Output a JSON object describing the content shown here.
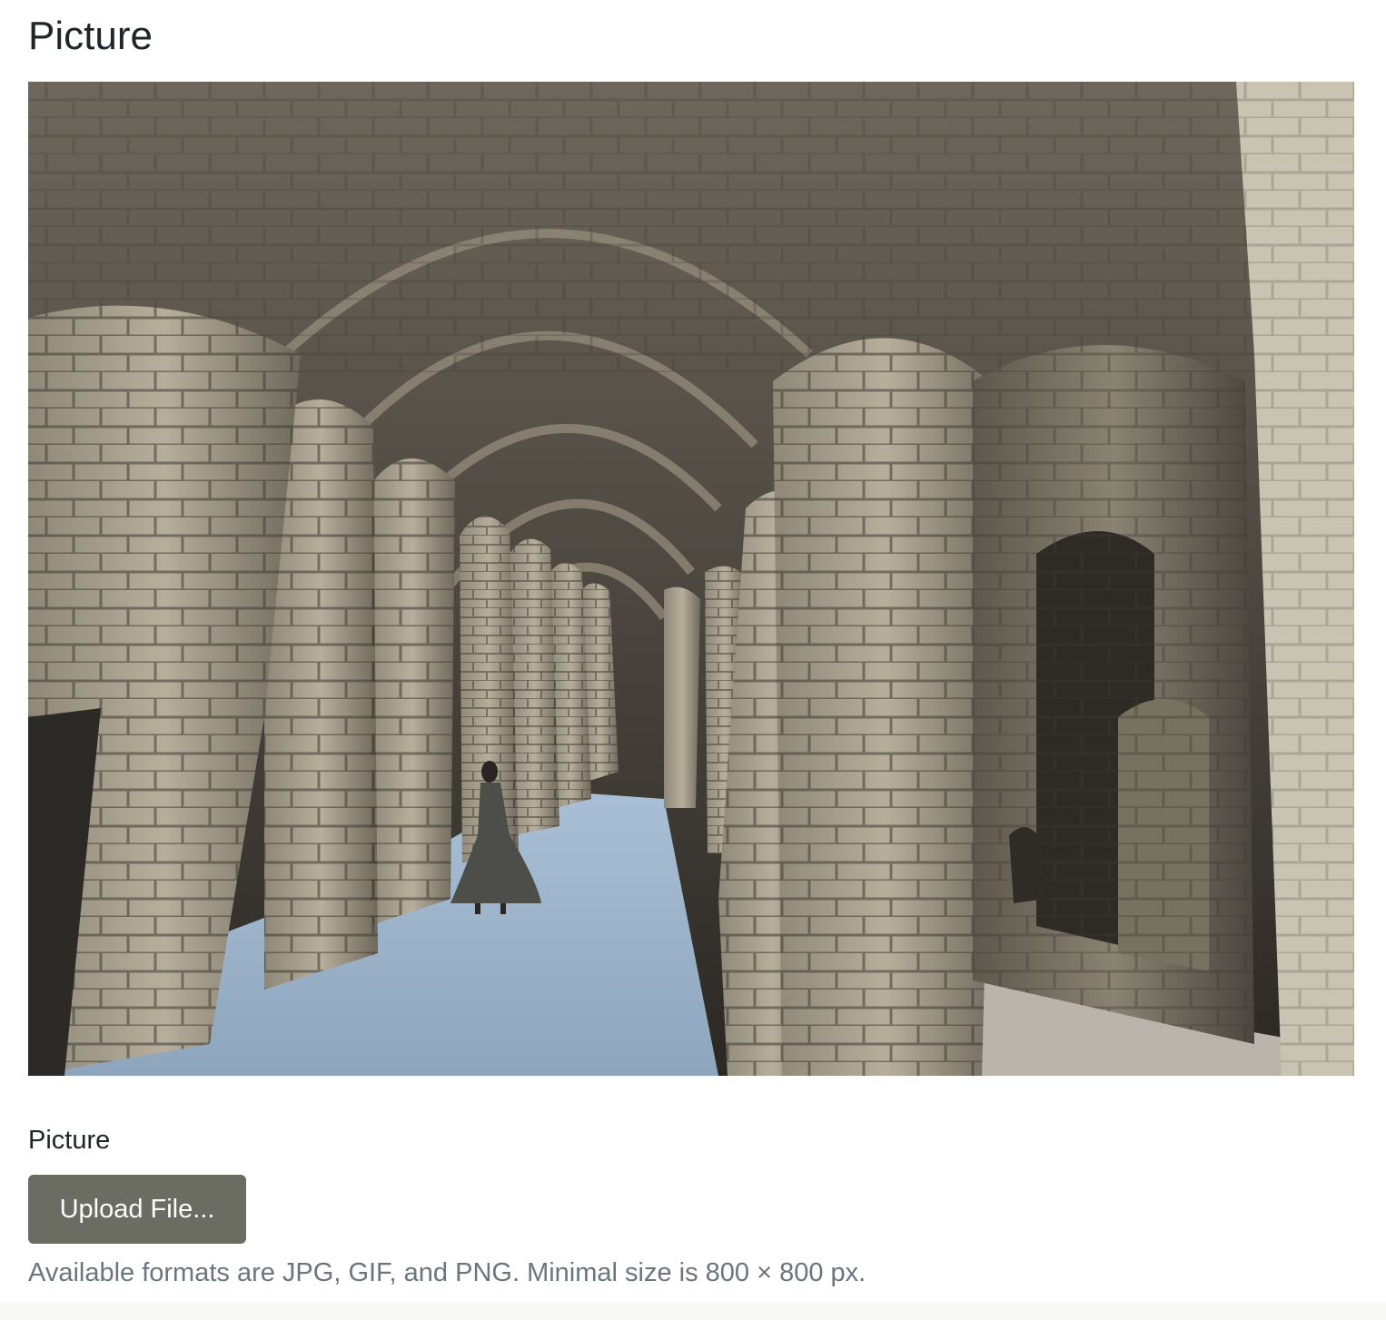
{
  "page": {
    "title": "Picture"
  },
  "picture": {
    "subject": "stone colonnade arches"
  },
  "upload": {
    "label": "Picture",
    "button_label": "Upload File...",
    "help_text": "Available formats are JPG, GIF, and PNG. Minimal size is 800 × 800 px."
  },
  "colors": {
    "button_background": "#6b6d63",
    "help_text": "#6c757d",
    "text": "#212529"
  }
}
